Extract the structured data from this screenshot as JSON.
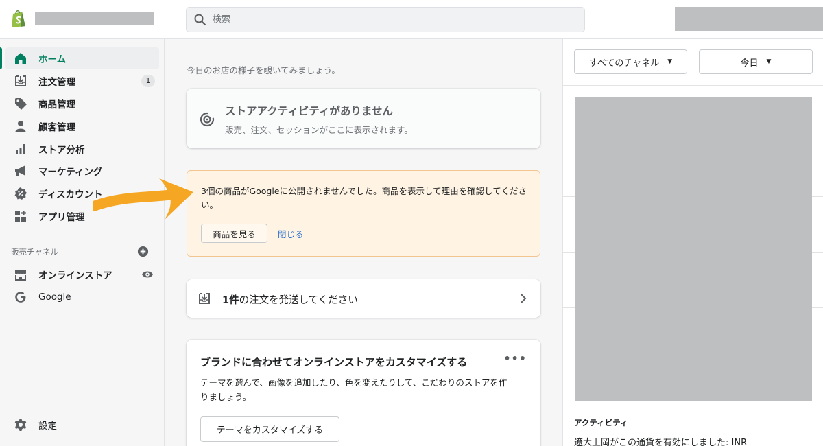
{
  "search": {
    "placeholder": "検索"
  },
  "sidebar": {
    "items": [
      {
        "label": "ホーム",
        "icon": "home-icon",
        "active": true
      },
      {
        "label": "注文管理",
        "icon": "orders-icon",
        "badge": "1"
      },
      {
        "label": "商品管理",
        "icon": "tag-icon"
      },
      {
        "label": "顧客管理",
        "icon": "person-icon"
      },
      {
        "label": "ストア分析",
        "icon": "analytics-icon"
      },
      {
        "label": "マーケティング",
        "icon": "megaphone-icon"
      },
      {
        "label": "ディスカウント",
        "icon": "discount-icon"
      },
      {
        "label": "アプリ管理",
        "icon": "apps-icon"
      }
    ],
    "sales_channels_label": "販売チャネル",
    "channels": [
      {
        "label": "オンラインストア",
        "icon": "store-icon"
      },
      {
        "label": "Google",
        "icon": "google-icon"
      }
    ],
    "settings_label": "設定"
  },
  "main": {
    "greeting": "今日のお店の様子を覗いてみましょう。",
    "activity_card": {
      "title": "ストアアクティビティがありません",
      "subtitle": "販売、注文、セッションがここに表示されます。"
    },
    "banner": {
      "message": "3個の商品がGoogleに公開されませんでした。商品を表示して理由を確認してください。",
      "view_button": "商品を見る",
      "dismiss_link": "閉じる"
    },
    "orders": {
      "count": "1件",
      "text": "の注文を発送してください"
    },
    "customize": {
      "title": "ブランドに合わせてオンラインストアをカスタマイズする",
      "description": "テーマを選んで、画像を追加したり、色を変えたりして、こだわりのストアを作りましょう。",
      "button": "テーマをカスタマイズする",
      "more": "•••"
    }
  },
  "right": {
    "channel_select": "すべてのチャネル",
    "date_select": "今日",
    "activity_heading": "アクティビティ",
    "activity_entry": "遼大上岡がこの通貨を有効にしました: INR"
  },
  "colors": {
    "accent": "#008060",
    "banner_bg": "#fff4e4",
    "banner_border": "#f2c590",
    "arrow": "#f5a623",
    "redacted": "#bdbfc1"
  }
}
